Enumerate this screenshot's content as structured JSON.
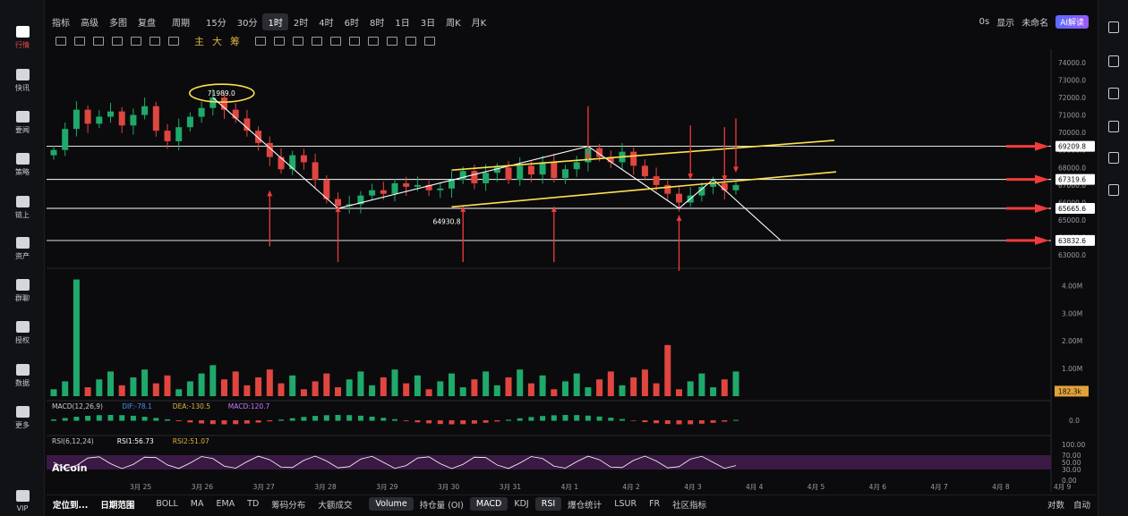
{
  "left_rail": [
    {
      "label": "行情",
      "icon": "chart-icon",
      "active": true
    },
    {
      "label": "快讯",
      "icon": "flash-icon"
    },
    {
      "label": "要闻",
      "icon": "news-icon"
    },
    {
      "label": "策略",
      "icon": "strategy-icon"
    },
    {
      "label": "链上",
      "icon": "chain-icon"
    },
    {
      "label": "资产",
      "icon": "wallet-icon"
    },
    {
      "label": "群聊",
      "icon": "chat-icon"
    },
    {
      "label": "授权",
      "icon": "auth-icon"
    },
    {
      "label": "数据",
      "icon": "data-icon"
    },
    {
      "label": "更多",
      "icon": "more-icon"
    },
    {
      "label": "VIP",
      "icon": "vip-icon"
    }
  ],
  "topbar": {
    "items": [
      "指标",
      "高级",
      "多图",
      "复盘",
      "周期",
      "15分",
      "30分",
      "1时",
      "2时",
      "4时",
      "6时",
      "8时",
      "1日",
      "3日",
      "周K",
      "月K"
    ],
    "active": "1时",
    "right": {
      "zero_s": "0s",
      "display": "显示",
      "unnamed": "未命名",
      "ai": "AI解读"
    }
  },
  "toolbar": {
    "labels": [
      "主",
      "大",
      "筹"
    ]
  },
  "chart_data": {
    "type": "candlestick",
    "price_axis": {
      "ticks": [
        74000,
        73000,
        72000,
        71000,
        70000,
        69000,
        68000,
        67000,
        66000,
        65000,
        64000,
        63000
      ],
      "ylim": [
        62500,
        74500
      ]
    },
    "x_axis": {
      "ticks": [
        "3月 25",
        "3月 26",
        "3月 27",
        "3月 28",
        "3月 29",
        "3月 30",
        "3月 31",
        "4月 1",
        "4月 2",
        "4月 3",
        "4月 4",
        "4月 5",
        "4月 6",
        "4月 7",
        "4月 8",
        "4月 9"
      ]
    },
    "key_prices": [
      {
        "value": 71989.0,
        "label": "71989.0"
      },
      {
        "value": 64930.8,
        "label": "64930.8"
      }
    ],
    "horizontal_levels": [
      {
        "value": 69209.8,
        "label": "69209.8"
      },
      {
        "value": 67319.6,
        "label": "67319.6"
      },
      {
        "value": 65665.6,
        "label": "65665.6"
      },
      {
        "value": 63832.6,
        "label": "63832.6"
      }
    ],
    "close_series": [
      69000,
      70200,
      71300,
      70500,
      70900,
      71200,
      70400,
      71000,
      71500,
      70100,
      69500,
      70300,
      70900,
      71400,
      71989,
      71300,
      70800,
      70100,
      69400,
      68600,
      67900,
      68700,
      68300,
      67300,
      66200,
      65800,
      65900,
      66400,
      66700,
      66500,
      67100,
      66900,
      67000,
      66700,
      66800,
      67300,
      67800,
      67100,
      67700,
      68000,
      67300,
      68100,
      67600,
      68300,
      67400,
      67900,
      68300,
      69100,
      68600,
      68300,
      68900,
      68100,
      67500,
      67000,
      66500,
      66000,
      66400,
      66900,
      67100,
      66700,
      67000
    ],
    "volume_axis": {
      "ticks": [
        "4.00M",
        "3.00M",
        "2.00M",
        "1.00M"
      ],
      "current": "182.3k"
    },
    "macd": {
      "title": "MACD(12,26,9)",
      "dif": "DIF:-78.1",
      "dea": "DEA:-130.5",
      "macd": "MACD:120.7",
      "axis": [
        "0.0"
      ]
    },
    "rsi": {
      "title": "RSI(6,12,24)",
      "rsi1": "RSI1:56.73",
      "rsi2": "RSI2:51.07",
      "axis": [
        "100.00",
        "70.00",
        "50.00",
        "30.00",
        "0.00"
      ]
    },
    "watermark": "AiCoin",
    "colors": {
      "up": "#1fa96a",
      "down": "#e0463f",
      "annotation": "#ffe14d",
      "arrow": "#f23b3b",
      "level_line": "#ffffff"
    }
  },
  "bottombar": {
    "left": [
      "定位到...",
      "日期范围"
    ],
    "items": [
      "BOLL",
      "MA",
      "EMA",
      "TD",
      "筹码分布",
      "大额成交",
      "Volume",
      "持仓量 (OI)",
      "MACD",
      "KDJ",
      "RSI",
      "爆仓统计",
      "LSUR",
      "FR",
      "社区指标"
    ],
    "active": [
      "Volume",
      "MACD",
      "RSI"
    ],
    "right": [
      "对数",
      "自动"
    ]
  }
}
